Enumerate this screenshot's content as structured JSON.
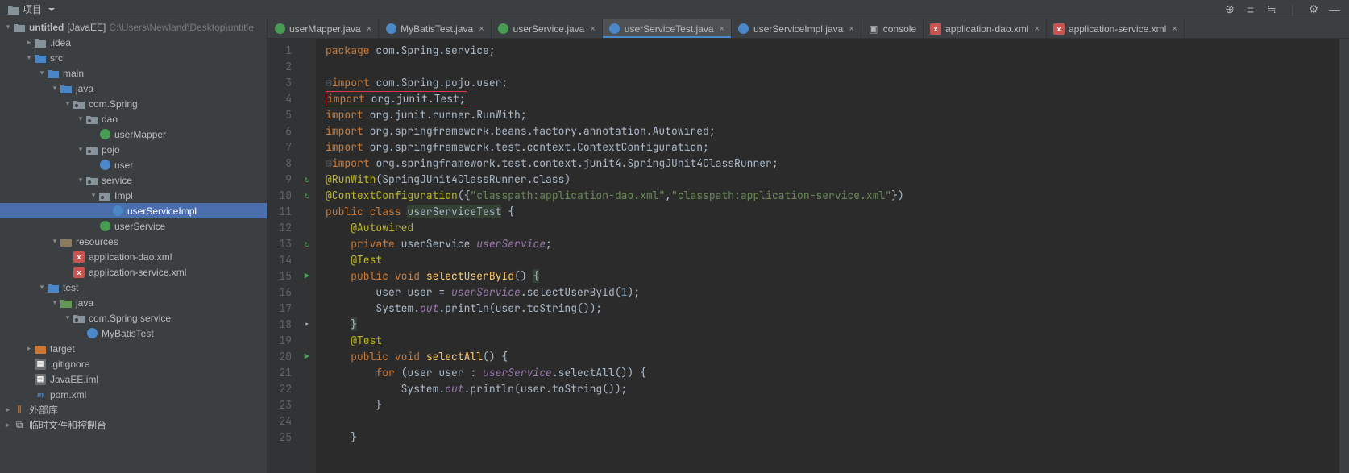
{
  "toolbar": {
    "project_label": "项目"
  },
  "tree": {
    "root_name": "untitled",
    "root_tag": "[JavaEE]",
    "root_path": "C:\\Users\\Newland\\Desktop\\untitle",
    "items": [
      {
        "d": 1,
        "exp": ">",
        "ico": "folder",
        "label": ".idea"
      },
      {
        "d": 1,
        "exp": "v",
        "ico": "folder-blue",
        "label": "src"
      },
      {
        "d": 2,
        "exp": "v",
        "ico": "folder-blue",
        "label": "main"
      },
      {
        "d": 3,
        "exp": "v",
        "ico": "folder-blue",
        "label": "java"
      },
      {
        "d": 4,
        "exp": "v",
        "ico": "package",
        "label": "com.Spring"
      },
      {
        "d": 5,
        "exp": "v",
        "ico": "package",
        "label": "dao"
      },
      {
        "d": 6,
        "exp": "",
        "ico": "interface",
        "label": "userMapper"
      },
      {
        "d": 5,
        "exp": "v",
        "ico": "package",
        "label": "pojo"
      },
      {
        "d": 6,
        "exp": "",
        "ico": "class",
        "label": "user"
      },
      {
        "d": 5,
        "exp": "v",
        "ico": "package",
        "label": "service"
      },
      {
        "d": 6,
        "exp": "v",
        "ico": "package",
        "label": "Impl"
      },
      {
        "d": 7,
        "exp": "",
        "ico": "class",
        "label": "userServiceImpl",
        "sel": true
      },
      {
        "d": 6,
        "exp": "",
        "ico": "interface",
        "label": "userService"
      },
      {
        "d": 3,
        "exp": "v",
        "ico": "folder-res",
        "label": "resources"
      },
      {
        "d": 4,
        "exp": "",
        "ico": "xml",
        "label": "application-dao.xml"
      },
      {
        "d": 4,
        "exp": "",
        "ico": "xml",
        "label": "application-service.xml"
      },
      {
        "d": 2,
        "exp": "v",
        "ico": "folder-blue",
        "label": "test"
      },
      {
        "d": 3,
        "exp": "v",
        "ico": "folder-green",
        "label": "java"
      },
      {
        "d": 4,
        "exp": "v",
        "ico": "package",
        "label": "com.Spring.service"
      },
      {
        "d": 5,
        "exp": "",
        "ico": "class",
        "label": "MyBatisTest"
      },
      {
        "d": 1,
        "exp": ">",
        "ico": "folder-orange",
        "label": "target"
      },
      {
        "d": 1,
        "exp": "",
        "ico": "file",
        "label": ".gitignore"
      },
      {
        "d": 1,
        "exp": "",
        "ico": "file",
        "label": "JavaEE.iml"
      },
      {
        "d": 1,
        "exp": "",
        "ico": "maven",
        "label": "pom.xml"
      }
    ],
    "libs": "外部库",
    "scratch": "临时文件和控制台"
  },
  "tabs": [
    {
      "ico": "interface",
      "label": "userMapper.java",
      "close": true
    },
    {
      "ico": "class",
      "label": "MyBatisTest.java",
      "close": true
    },
    {
      "ico": "interface",
      "label": "userService.java",
      "close": true
    },
    {
      "ico": "class",
      "label": "userServiceTest.java",
      "close": true,
      "active": true
    },
    {
      "ico": "class",
      "label": "userServiceImpl.java",
      "close": true
    },
    {
      "ico": "console",
      "label": "console",
      "close": false
    },
    {
      "ico": "xml",
      "label": "application-dao.xml",
      "close": true
    },
    {
      "ico": "xml",
      "label": "application-service.xml",
      "close": true
    }
  ],
  "gutter": {
    "start": 1,
    "end": 25,
    "marks": {
      "9": "recycle",
      "10": "recycle",
      "13": "recycle",
      "15": "run",
      "18": "cursor",
      "20": "run"
    }
  },
  "code": {
    "pkg_stmt": "package com.Spring.service;",
    "imports": [
      "import com.Spring.pojo.user;",
      "import org.junit.Test;",
      "import org.junit.runner.RunWith;",
      "import org.springframework.beans.factory.annotation.Autowired;",
      "import org.springframework.test.context.ContextConfiguration;",
      "import org.springframework.test.context.junit4.SpringJUnit4ClassRunner;"
    ],
    "runwith_ann": "@RunWith",
    "runwith_arg": "(SpringJUnit4ClassRunner.class)",
    "ctxcfg_ann": "@ContextConfiguration",
    "ctxcfg_open": "({",
    "ctxcfg_s1": "\"classpath:application-dao.xml\"",
    "ctxcfg_comma": ",",
    "ctxcfg_s2": "\"classpath:application-service.xml\"",
    "ctxcfg_close": "})",
    "class_sig": "public class ",
    "class_name": "userServiceTest",
    "brace_open": " {",
    "autowired": "@Autowired",
    "priv": "private ",
    "svcType": "userService ",
    "svcField": "userService",
    "test_ann": "@Test",
    "m1_sig": "public void ",
    "m1_name": "selectUserById",
    "m1_paren": "() ",
    "m1_brace": "{",
    "m1_line1a": "user user = ",
    "m1_line1b": "userService",
    "m1_line1c": ".selectUserById(",
    "m1_num": "1",
    "m1_line1d": ");",
    "m1_line2a": "System.",
    "m1_out": "out",
    "m1_line2b": ".println(user.toString());",
    "m1_close": "}",
    "m2_sig": "public void ",
    "m2_name": "selectAll",
    "m2_paren": "() {",
    "m2_for": "for ",
    "m2_for_body": "(user user : ",
    "m2_for_svc": "userService",
    "m2_for_call": ".selectAll()) {",
    "m2_line": "System.",
    "m2_out": "out",
    "m2_line2": ".println(user.toString());",
    "m2_for_close": "}",
    "m2_close": "}"
  }
}
